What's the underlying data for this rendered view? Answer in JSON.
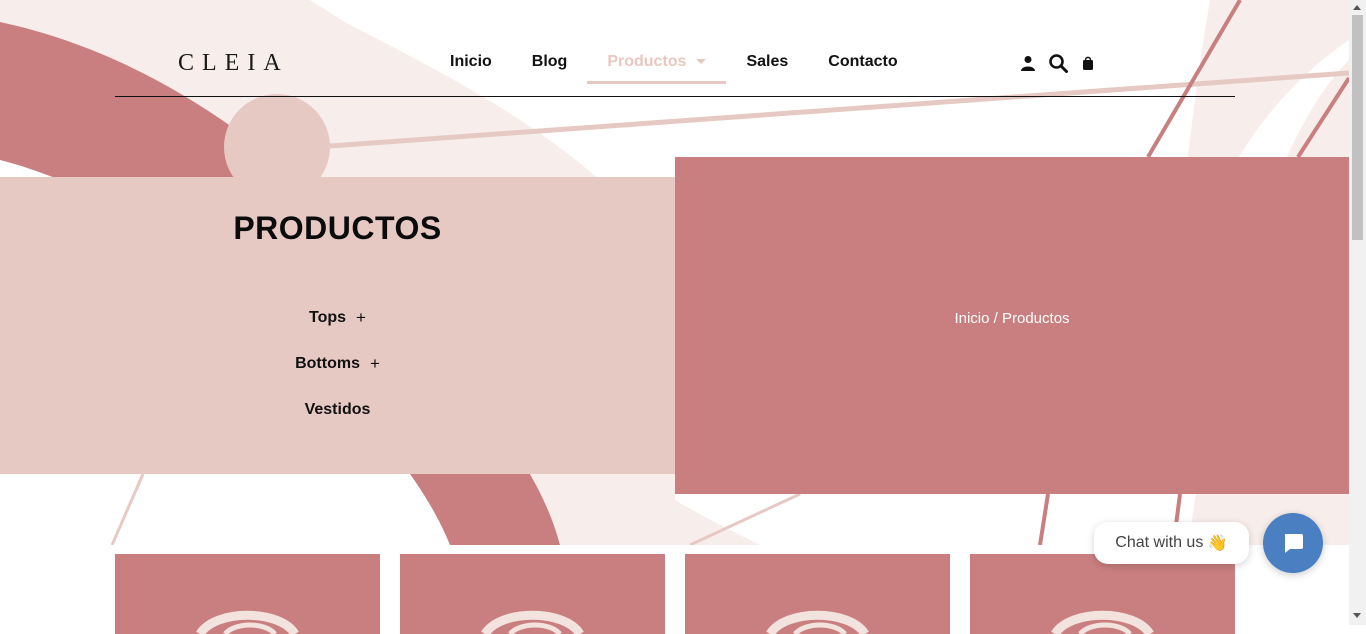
{
  "brand": {
    "logo": "CLEIA"
  },
  "nav": {
    "items": [
      {
        "label": "Inicio"
      },
      {
        "label": "Blog"
      },
      {
        "label": "Productos"
      },
      {
        "label": "Sales"
      },
      {
        "label": "Contacto"
      }
    ]
  },
  "header_icons": [
    "user-icon",
    "search-icon",
    "bag-icon"
  ],
  "hero": {
    "title": "PRODUCTOS",
    "categories": [
      {
        "label": "Tops",
        "expand": "+"
      },
      {
        "label": "Bottoms",
        "expand": "+"
      },
      {
        "label": "Vestidos"
      }
    ],
    "breadcrumb": {
      "home": "Inicio",
      "separator": " / ",
      "current": "Productos"
    }
  },
  "chat": {
    "label": "Chat with us",
    "emoji": "👋"
  },
  "colors": {
    "rose": "#c97f7f",
    "blush": "#e7c9c3",
    "cream": "#f7eeeb",
    "chat_blue": "#4a7fc1"
  }
}
